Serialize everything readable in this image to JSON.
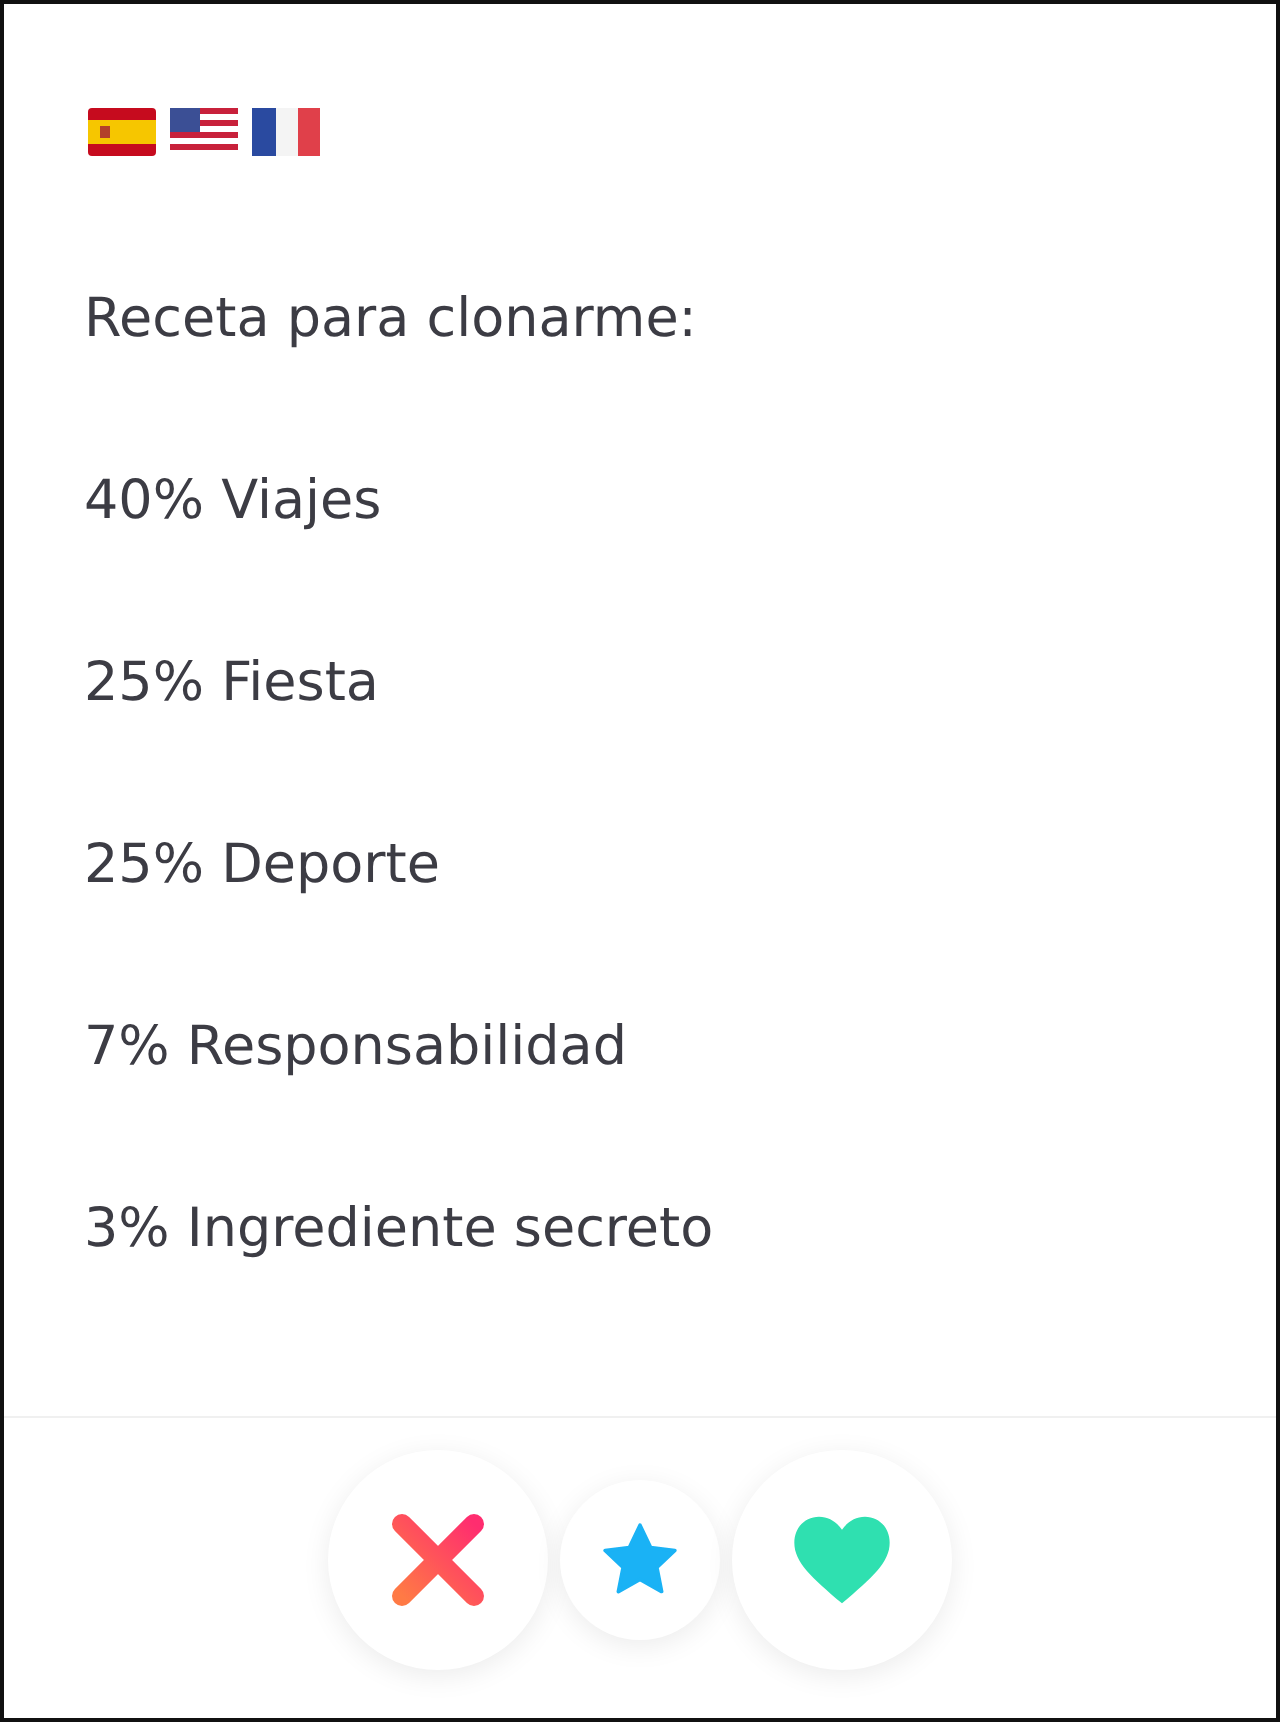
{
  "bio": {
    "heading": "Receta para clonarme:",
    "ingredients": [
      "40% Viajes",
      "25% Fiesta",
      "25% Deporte",
      "7% Responsabilidad",
      "3% Ingrediente secreto"
    ]
  }
}
